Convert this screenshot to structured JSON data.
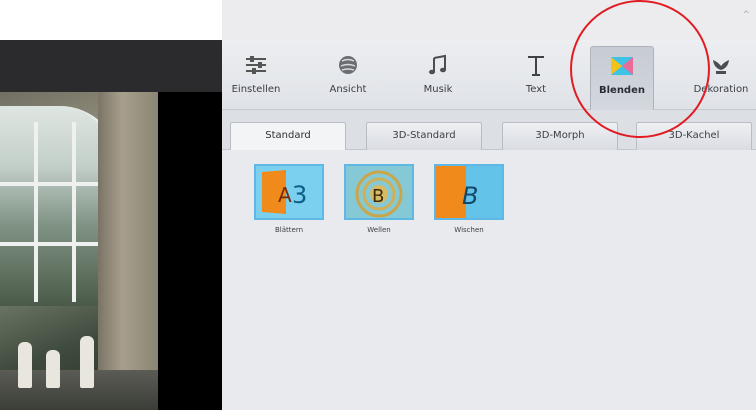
{
  "toolbar": {
    "items": [
      {
        "label": "Einstellen",
        "icon": "sliders-icon"
      },
      {
        "label": "Ansicht",
        "icon": "globe-icon"
      },
      {
        "label": "Musik",
        "icon": "music-note-icon"
      },
      {
        "label": "Text",
        "icon": "text-t-icon"
      },
      {
        "label": "Blenden",
        "icon": "transition-icon",
        "active": true
      },
      {
        "label": "Dekoration",
        "icon": "flower-icon"
      }
    ]
  },
  "tabs": [
    {
      "label": "Standard",
      "active": true
    },
    {
      "label": "3D-Standard"
    },
    {
      "label": "3D-Morph"
    },
    {
      "label": "3D-Kachel"
    }
  ],
  "effects": [
    {
      "label": "Blättern",
      "icon": "page-flip-icon",
      "glyph": "A3"
    },
    {
      "label": "Wellen",
      "icon": "wave-icon",
      "glyph": "B"
    },
    {
      "label": "Wischen",
      "icon": "wipe-icon",
      "glyph": "B"
    }
  ],
  "colors": {
    "accent_blue": "#5fb7e5",
    "active_tab_orange": "#f08a1a",
    "annotation_red": "#e11b22"
  }
}
